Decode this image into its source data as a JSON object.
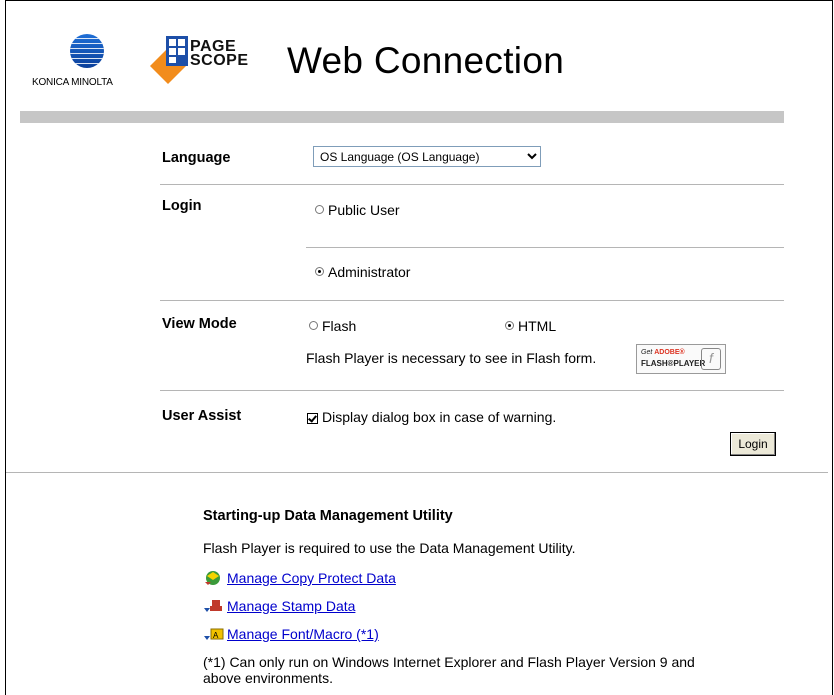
{
  "header": {
    "brand": "KONICA MINOLTA",
    "logo_word_top": "PAGE",
    "logo_word_bottom": "SCOPE",
    "title": "Web Connection"
  },
  "form": {
    "language": {
      "label": "Language",
      "selected": "OS Language (OS Language)"
    },
    "login": {
      "label": "Login",
      "options": [
        {
          "label": "Public User",
          "checked": false
        },
        {
          "label": "Administrator",
          "checked": true
        }
      ]
    },
    "view_mode": {
      "label": "View Mode",
      "options": [
        {
          "label": "Flash",
          "checked": false
        },
        {
          "label": "HTML",
          "checked": true
        }
      ],
      "note": "Flash Player is necessary to see in Flash form.",
      "badge_get": "Get",
      "badge_adobe": "ADOBE®",
      "badge_player": "FLASH®PLAYER"
    },
    "user_assist": {
      "label": "User Assist",
      "checkbox_label": "Display dialog box in case of warning.",
      "checked": true
    },
    "login_button": "Login"
  },
  "utility": {
    "title": "Starting-up Data Management Utility",
    "description": "Flash Player is required to use the Data Management Utility.",
    "links": [
      {
        "label": "Manage Copy Protect Data",
        "icon": "copy-protect-icon"
      },
      {
        "label": "Manage Stamp Data",
        "icon": "stamp-icon"
      },
      {
        "label": "Manage Font/Macro (*1)",
        "icon": "font-macro-icon"
      }
    ],
    "footnote_line1": "(*1) Can only run on Windows Internet Explorer and Flash Player Version 9 and",
    "footnote_line2": "above environments."
  }
}
